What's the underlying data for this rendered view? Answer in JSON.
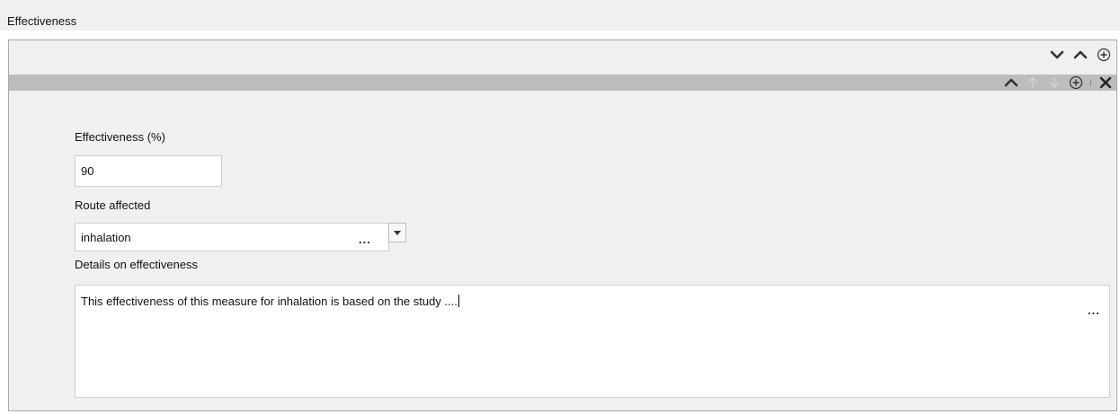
{
  "section": {
    "title": "Effectiveness"
  },
  "icons": {
    "top_toolbar": [
      "chevron-down-icon",
      "chevron-up-icon",
      "add-circle-icon"
    ],
    "record_toolbar": [
      "chevron-up-icon",
      "arrow-up-icon",
      "arrow-down-icon",
      "add-circle-icon",
      "close-icon"
    ]
  },
  "fields": {
    "effectiveness": {
      "label": "Effectiveness (%)",
      "value": "90"
    },
    "route": {
      "label": "Route affected",
      "value": "inhalation",
      "browse": "..."
    },
    "details": {
      "label": "Details on effectiveness",
      "value": "This effectiveness of this measure for inhalation is based on the study ....",
      "browse": "..."
    }
  },
  "colors": {
    "panel_bg": "#f0f0f0",
    "record_bar": "#bdbdbd",
    "border": "#a9a9a9",
    "disabled_icon": "#d0d0d0"
  }
}
